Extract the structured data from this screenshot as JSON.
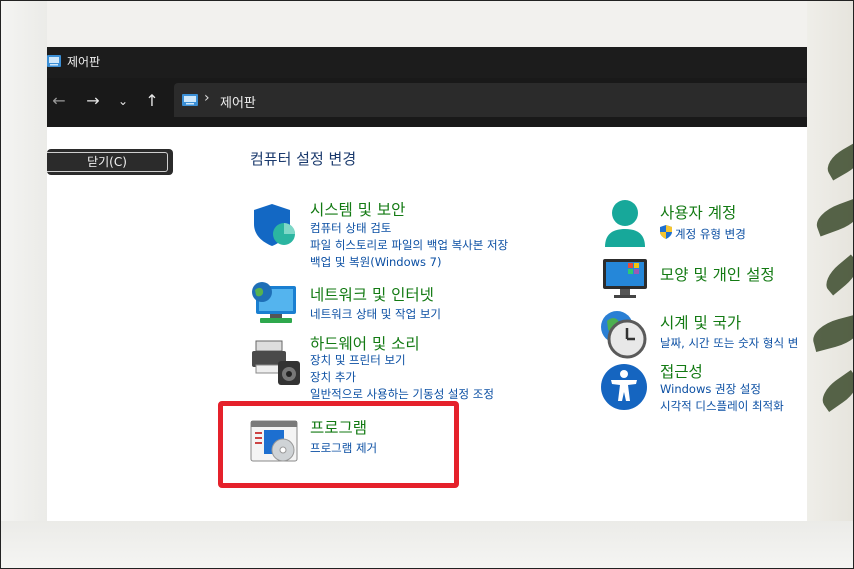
{
  "window": {
    "title": "제어판",
    "address": {
      "location": "제어판"
    }
  },
  "sidebar": {
    "close_label": "닫기(C)"
  },
  "main": {
    "heading": "컴퓨터 설정 변경",
    "categories": [
      {
        "title": "시스템 및 보안",
        "links": [
          "컴퓨터 상태 검토",
          "파일 히스토리로 파일의 백업 복사본 저장",
          "백업 및 복원(Windows 7)"
        ],
        "icon": "shield-icon"
      },
      {
        "title": "네트워크 및 인터넷",
        "links": [
          "네트워크 상태 및 작업 보기"
        ],
        "icon": "network-icon"
      },
      {
        "title": "하드웨어 및 소리",
        "links": [
          "장치 및 프린터 보기",
          "장치 추가",
          "일반적으로 사용하는 기동성 설정 조정"
        ],
        "icon": "printer-speaker-icon"
      },
      {
        "title": "프로그램",
        "links": [
          "프로그램 제거"
        ],
        "icon": "programs-icon"
      },
      {
        "title": "사용자 계정",
        "links": [
          "계정 유형 변경"
        ],
        "icon": "user-icon"
      },
      {
        "title": "모양 및 개인 설정",
        "links": [],
        "icon": "monitor-icon"
      },
      {
        "title": "시계 및 국가",
        "links": [
          "날짜, 시간 또는 숫자 형식 변"
        ],
        "icon": "clock-globe-icon"
      },
      {
        "title": "접근성",
        "links": [
          "Windows 권장 설정",
          "시각적 디스플레이 최적화"
        ],
        "icon": "accessibility-icon"
      }
    ]
  },
  "colors": {
    "highlight": "#e5212b",
    "category_title": "#137a13",
    "link": "#0b4fa3",
    "heading": "#1c3b6e",
    "titlebar": "#1c1c1c"
  }
}
